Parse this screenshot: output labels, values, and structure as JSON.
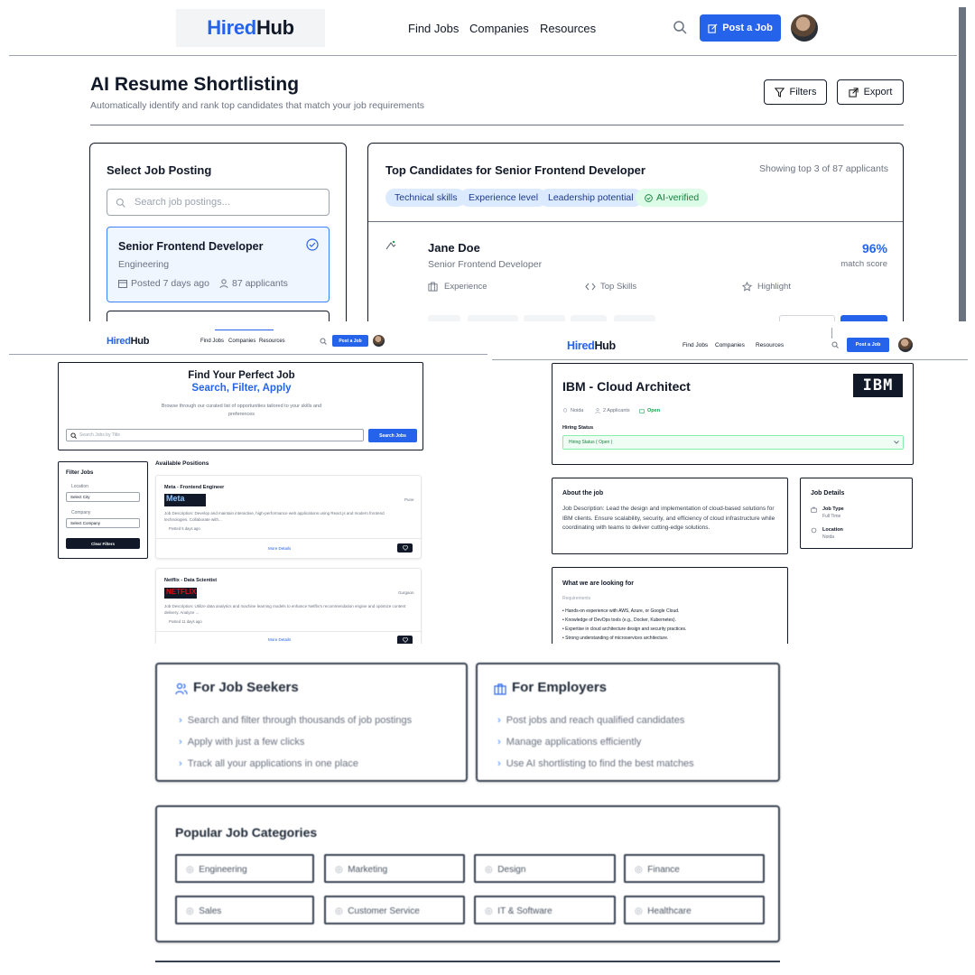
{
  "brand": {
    "part1": "Hired",
    "part2": "Hub"
  },
  "nav": {
    "find_jobs": "Find Jobs",
    "companies": "Companies",
    "resources": "Resources",
    "post_job": "Post a Job"
  },
  "shortlist": {
    "title": "AI Resume Shortlisting",
    "subtitle": "Automatically identify and rank top candidates that match your job requirements",
    "filters_label": "Filters",
    "export_label": "Export",
    "select_title": "Select Job Posting",
    "search_placeholder": "Search job postings...",
    "job": {
      "title": "Senior Frontend Developer",
      "department": "Engineering",
      "posted": "Posted 7 days ago",
      "applicants": "87 applicants"
    },
    "candidates_title": "Top Candidates for Senior Frontend Developer",
    "showing": "Showing top 3 of 87 applicants",
    "chips": [
      "Technical skills",
      "Experience level",
      "Leadership potential",
      "AI-verified"
    ],
    "candidate": {
      "name": "Jane Doe",
      "role": "Senior Frontend Developer",
      "score": "96%",
      "score_label": "match score",
      "col1": "Experience",
      "col2": "Top Skills",
      "col3": "Highlight"
    }
  },
  "jobs_page": {
    "hero_title": "Find Your Perfect Job",
    "hero_sub": "Search, Filter, Apply",
    "hero_desc": "Browse through our curated list of opportunities tailored to your skills and preferences",
    "search_placeholder": "Search Jobs by Title",
    "search_button": "Search Jobs",
    "filter_title": "Filter Jobs",
    "location_label": "Location",
    "location_value": "Select City",
    "company_label": "Company",
    "company_value": "Select Company",
    "clear_button": "Clear Filters",
    "available": "Available Positions",
    "jobs": [
      {
        "title": "Meta - Frontend Engineer",
        "logo": "Meta",
        "location": "Pune",
        "desc": "Job Description: Develop and maintain interactive, high-performance web applications using React.js and modern frontend technologies. Collaborate with...",
        "posted": "Posted 5 days ago",
        "details": "More Details"
      },
      {
        "title": "Netflix - Data Scientist",
        "logo": "NETFLIX",
        "location": "Gurgaon",
        "desc": "Job Description: Utilize data analytics and machine learning models to enhance Netflix's recommendation engine and optimize content delivery. Analyze ...",
        "posted": "Posted 11 days ago",
        "details": "More Details"
      }
    ]
  },
  "job_detail": {
    "title": "IBM - Cloud Architect",
    "logo": "IBM",
    "location": "Noida",
    "applicants": "2 Applicants",
    "status": "Open",
    "hiring_label": "Hiring Status",
    "hiring_value": "Hiring Status ( Open )",
    "about_title": "About the job",
    "about_text": "Job Description: Lead the design and implementation of cloud-based solutions for IBM clients. Ensure scalability, security, and efficiency of cloud infrastructure while coordinating with teams to deliver cutting-edge solutions.",
    "details_title": "Job Details",
    "job_type_label": "Job Type",
    "job_type_value": "Full Time",
    "location_label": "Location",
    "location_value": "Noida",
    "looking_title": "What we are looking for",
    "requirements_label": "Requirements",
    "requirements": [
      "Hands-on experience with AWS, Azure, or Google Cloud.",
      "Knowledge of DevOps tools (e.g., Docker, Kubernetes).",
      "Expertise in cloud architecture design and security practices.",
      "Strong understanding of microservices architecture."
    ]
  },
  "home": {
    "seekers_title": "For Job Seekers",
    "seekers": [
      "Search and filter through thousands of job postings",
      "Apply with just a few clicks",
      "Track all your applications in one place"
    ],
    "employers_title": "For Employers",
    "employers": [
      "Post jobs and reach qualified candidates",
      "Manage applications efficiently",
      "Use AI shortlisting to find the best matches"
    ],
    "categories_title": "Popular Job Categories",
    "categories": [
      "Engineering",
      "Marketing",
      "Design",
      "Finance",
      "Sales",
      "Customer Service",
      "IT & Software",
      "Healthcare"
    ]
  },
  "colors": {
    "accent": "#2563eb",
    "chip_bg": "#dbeafe",
    "success": "#16a34a"
  }
}
